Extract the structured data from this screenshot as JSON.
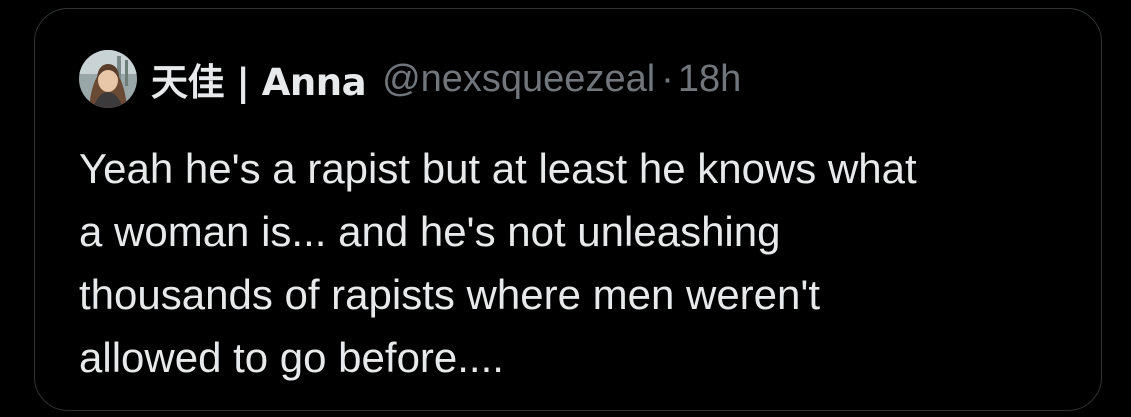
{
  "tweet": {
    "author": {
      "display_name": "天佳 | Anna",
      "handle": "@nexsqueezeal",
      "avatar_icon": "avatar-photo"
    },
    "separator": "·",
    "timestamp": "18h",
    "text_lines": [
      "Yeah he's a rapist but at least he knows what",
      "a woman is... and he's not unleashing",
      "thousands of rapists where men weren't",
      "allowed to go before...."
    ]
  },
  "colors": {
    "background": "#000000",
    "border": "#2f3336",
    "primary_text": "#e7e9ea",
    "secondary_text": "#71767b"
  }
}
